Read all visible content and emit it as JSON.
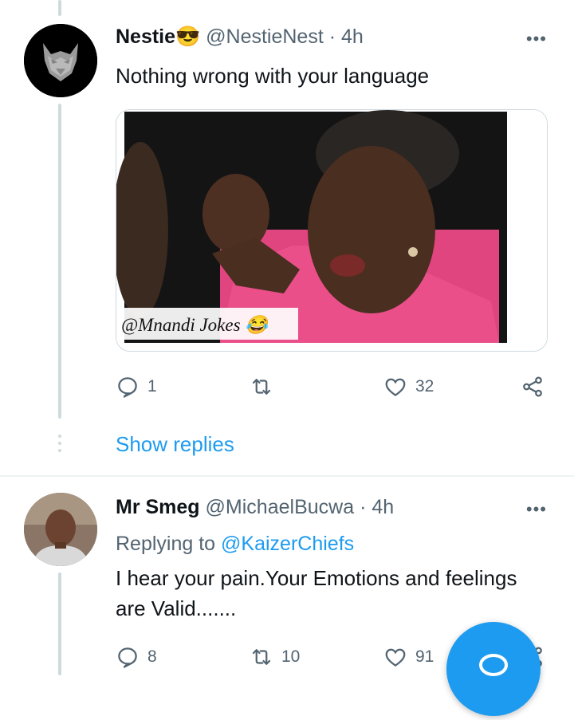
{
  "tweet1": {
    "name": "Nestie",
    "name_emoji": "😎",
    "handle": "@NestieNest",
    "separator": "·",
    "time": "4h",
    "more_label": "•••",
    "text": "Nothing wrong with your language",
    "media": {
      "watermark": "@Mnandi Jokes",
      "watermark_emoji": "😂"
    },
    "actions": {
      "reply_count": "1",
      "retweet_count": "",
      "like_count": "32"
    },
    "show_replies": "Show replies"
  },
  "tweet2": {
    "name": "Mr Smeg",
    "handle": "@MichaelBucwa",
    "separator": "·",
    "time": "4h",
    "more_label": "•••",
    "replying_prefix": "Replying to",
    "replying_to": "@KaizerChiefs",
    "text_line1": "I hear your pain.Your Emotions and feelings",
    "text_line2": "are Valid.......",
    "actions": {
      "reply_count": "8",
      "retweet_count": "10",
      "like_count": "91"
    }
  },
  "colors": {
    "accent": "#1d9bf0",
    "secondary_text": "#536471",
    "border": "#cfd9de"
  }
}
